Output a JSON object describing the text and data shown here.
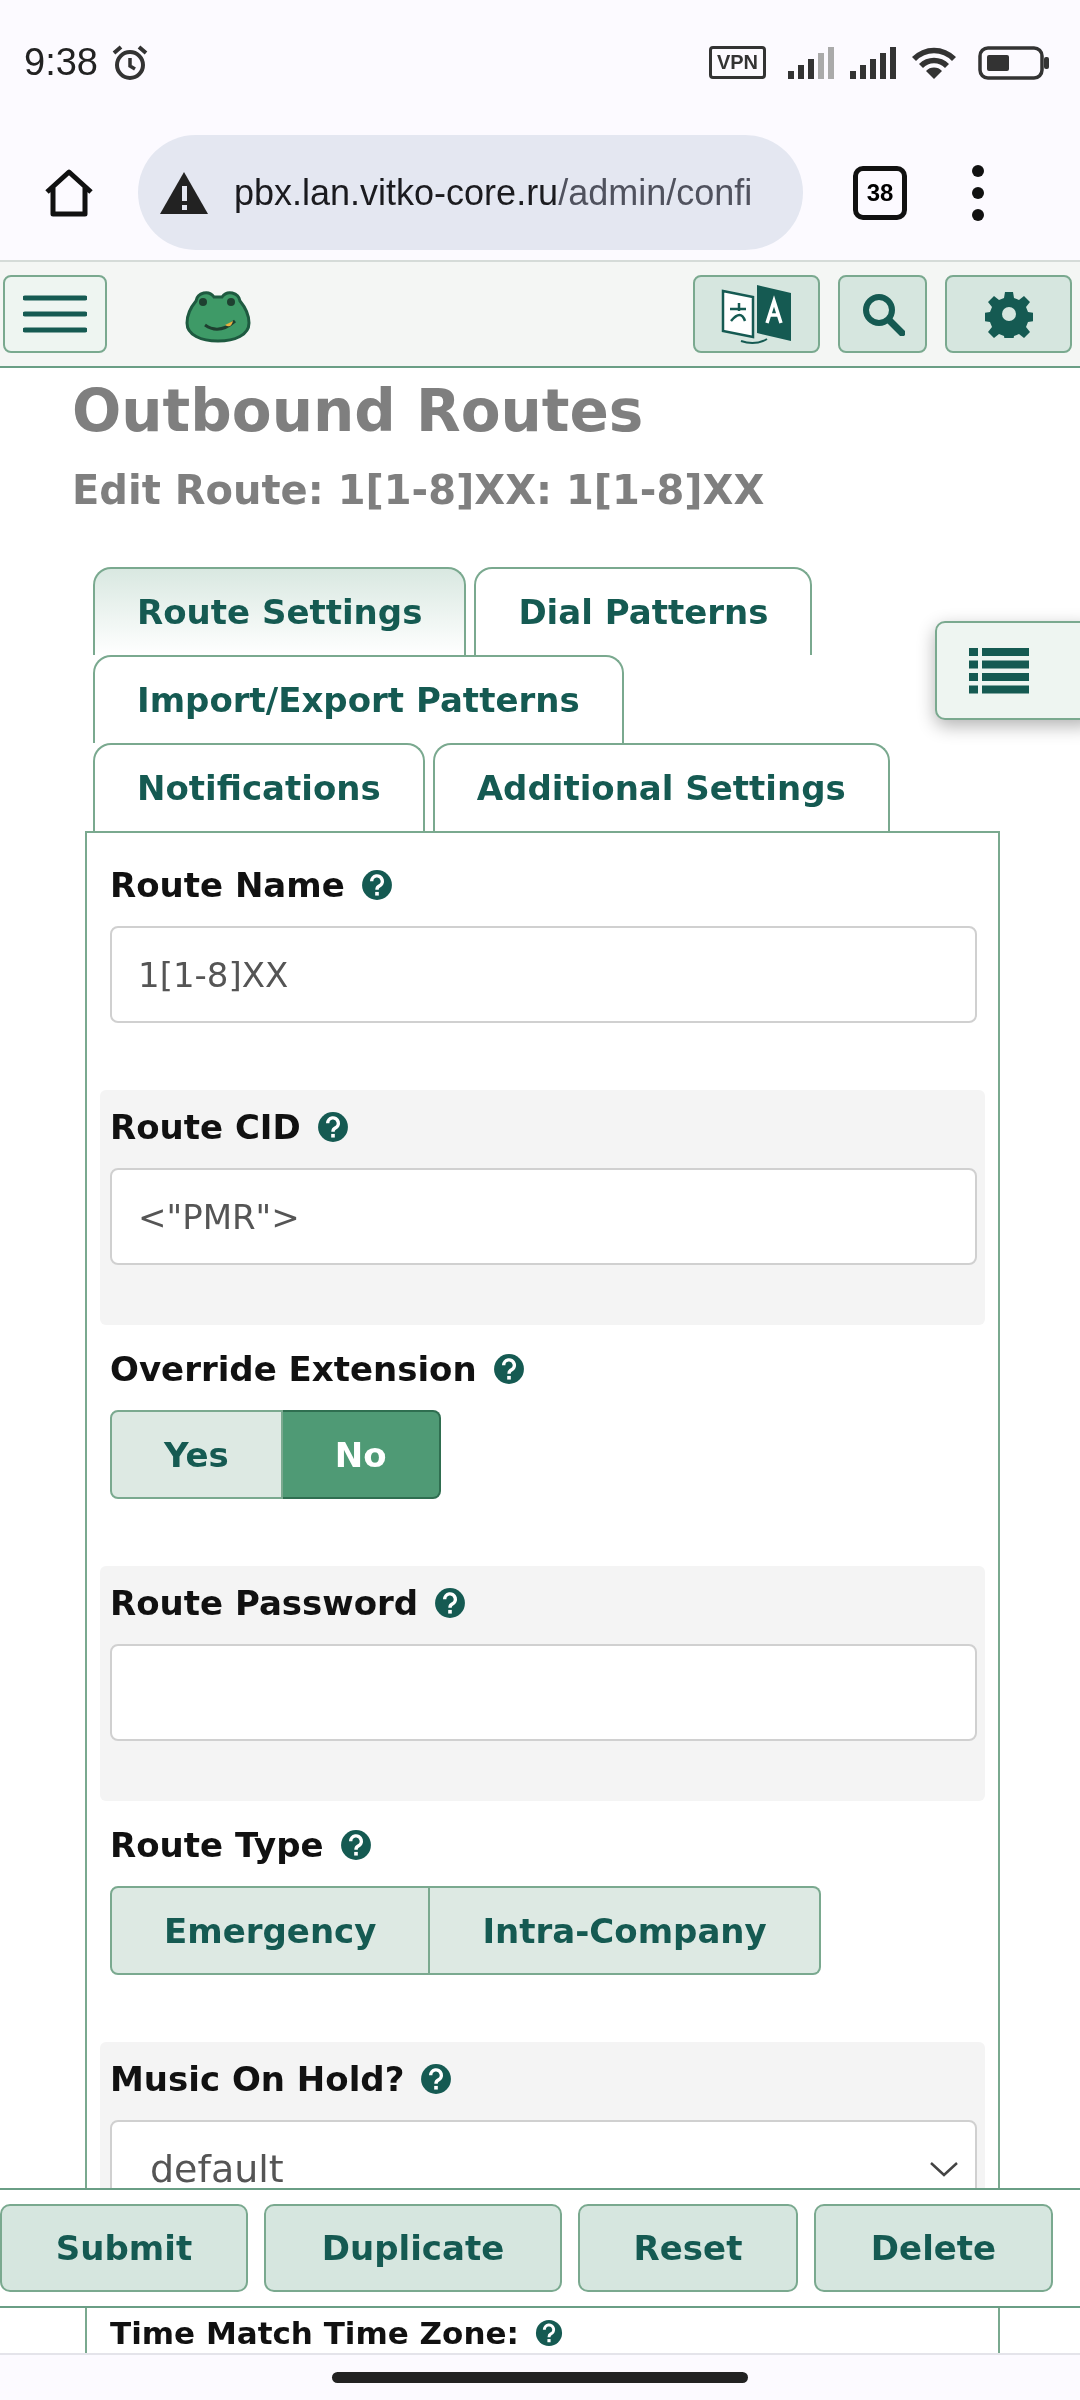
{
  "status_bar": {
    "time": "9:38",
    "vpn": "VPN"
  },
  "browser": {
    "url_host": "pbx.lan.vitko-core.ru",
    "url_path": "/admin/confi",
    "tab_count": "38"
  },
  "page": {
    "title": "Outbound Routes",
    "subtitle": "Edit Route: 1[1-8]XX: 1[1-8]XX"
  },
  "tabs": [
    {
      "label": "Route Settings",
      "selected": true
    },
    {
      "label": "Dial Patterns",
      "selected": false
    },
    {
      "label": "Import/Export Patterns",
      "selected": false
    },
    {
      "label": "Notifications",
      "selected": false
    },
    {
      "label": "Additional Settings",
      "selected": false
    }
  ],
  "fields": [
    {
      "kind": "text",
      "label": "Route Name",
      "value": "1[1-8]XX"
    },
    {
      "kind": "text",
      "label": "Route CID",
      "value": "<\"PMR\">"
    },
    {
      "kind": "toggle",
      "label": "Override Extension",
      "options": [
        {
          "label": "Yes",
          "selected": false
        },
        {
          "label": "No",
          "selected": true
        }
      ]
    },
    {
      "kind": "text",
      "label": "Route Password"
    },
    {
      "kind": "toggle",
      "label": "Route Type",
      "options": [
        {
          "label": "Emergency",
          "selected": false
        },
        {
          "label": "Intra-Company",
          "selected": false
        }
      ]
    },
    {
      "kind": "select",
      "label": "Music On Hold?",
      "value": "default"
    },
    {
      "kind": "label",
      "label": "Time Match Time Zone:"
    }
  ],
  "actions": [
    "Submit",
    "Duplicate",
    "Reset",
    "Delete"
  ]
}
